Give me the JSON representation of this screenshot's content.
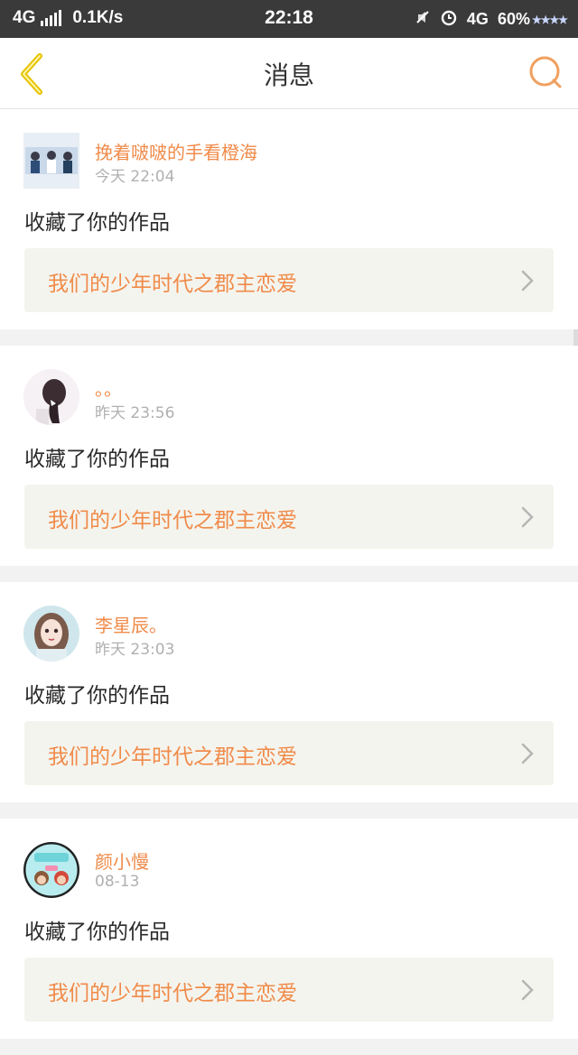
{
  "status_bar": {
    "network_left": "4G",
    "speed": "0.1K/s",
    "time": "22:18",
    "network_right": "4G",
    "battery": "60%"
  },
  "header": {
    "title": "消息"
  },
  "messages": [
    {
      "name": "挽着啵啵的手看橙海",
      "time": "今天 22:04",
      "action": "收藏了你的作品",
      "work_title": "我们的少年时代之郡主恋爱",
      "avatar": "group-photo-avatar"
    },
    {
      "name": "。。",
      "time": "昨天 23:56",
      "action": "收藏了你的作品",
      "work_title": "我们的少年时代之郡主恋爱",
      "avatar": "girl-back-avatar"
    },
    {
      "name": "李星辰。",
      "time": "昨天 23:03",
      "action": "收藏了你的作品",
      "work_title": "我们的少年时代之郡主恋爱",
      "avatar": "illustrated-girl-avatar"
    },
    {
      "name": "颜小慢",
      "time": "08-13",
      "action": "收藏了你的作品",
      "work_title": "我们的少年时代之郡主恋爱",
      "avatar": "cartoon-avatar"
    }
  ],
  "colors": {
    "accent": "#f08b4a",
    "back_arrow": "#e6c300"
  }
}
